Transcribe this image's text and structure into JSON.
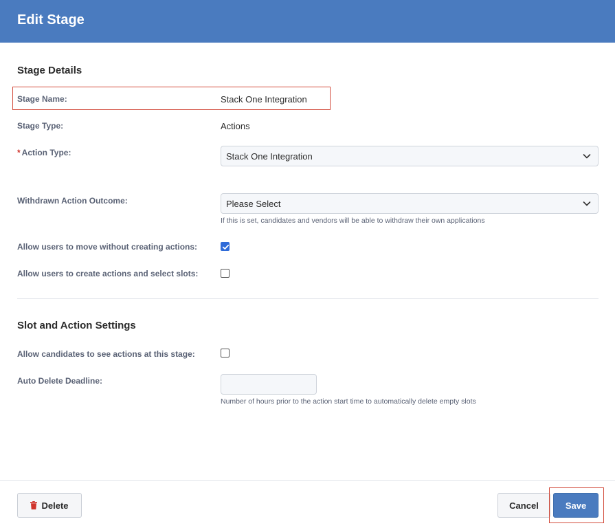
{
  "header": {
    "title": "Edit Stage"
  },
  "stage_details": {
    "title": "Stage Details",
    "stage_name_label": "Stage Name:",
    "stage_name_value": "Stack One Integration",
    "stage_type_label": "Stage Type:",
    "stage_type_value": "Actions",
    "action_type_required_mark": "*",
    "action_type_label": "Action Type:",
    "action_type_selected": "Stack One Integration",
    "withdrawn_label": "Withdrawn Action Outcome:",
    "withdrawn_selected": "Please Select",
    "withdrawn_help": "If this is set, candidates and vendors will be able to withdraw their own applications",
    "allow_move_label": "Allow users to move without creating actions:",
    "allow_move_checked": true,
    "allow_create_label": "Allow users to create actions and select slots:",
    "allow_create_checked": false
  },
  "slot_settings": {
    "title": "Slot and Action Settings",
    "allow_candidates_label": "Allow candidates to see actions at this stage:",
    "allow_candidates_checked": false,
    "auto_delete_label": "Auto Delete Deadline:",
    "auto_delete_value": "",
    "auto_delete_help": "Number of hours prior to the action start time to automatically delete empty slots"
  },
  "footer": {
    "delete_label": "Delete",
    "cancel_label": "Cancel",
    "save_label": "Save"
  },
  "colors": {
    "header_bg": "#4a7bbf",
    "save_bg": "#4a7bbf",
    "highlight_border": "#d24a3a",
    "required_star": "#d0342c",
    "checkbox_checked": "#2f6bd8",
    "trash_icon": "#d0342c"
  },
  "icons": {
    "dropdown": "chevron-down-icon",
    "delete": "trash-icon",
    "checked": "checkmark-icon"
  }
}
